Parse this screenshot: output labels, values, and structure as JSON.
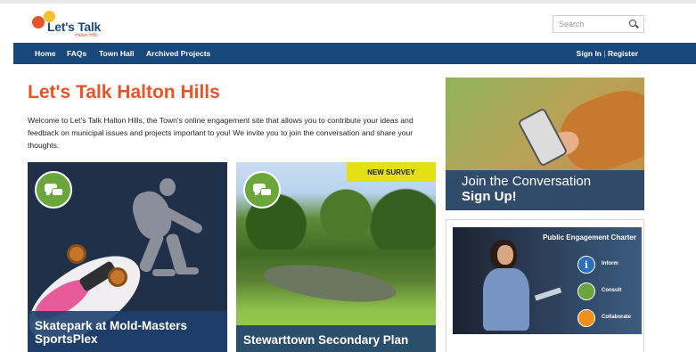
{
  "header": {
    "logo_name": "Let's Talk",
    "logo_sub": "Halton Hills",
    "search_placeholder": "Search"
  },
  "nav": {
    "items": [
      "Home",
      "FAQs",
      "Town Hall",
      "Archived Projects"
    ],
    "sign_in": "Sign In",
    "separator": "|",
    "register": "Register"
  },
  "intro": {
    "title": "Let's Talk Halton Hills",
    "body": "Welcome to Let's Talk Halton Hills, the Town's online engagement site that allows you to contribute your ideas and feedback on municipal issues and projects important to you! We invite you to join the conversation and share your thoughts."
  },
  "tiles": [
    {
      "caption": "Skatepark at Mold-Masters SportsPlex",
      "icon": "discussion-icon"
    },
    {
      "caption": "Stewarttown Secondary Plan",
      "badge": "NEW SURVEY",
      "icon": "discussion-icon"
    }
  ],
  "join": {
    "line1": "Join the Conversation",
    "line2": "Sign Up!"
  },
  "charter": {
    "title": "Public Engagement Charter",
    "levels": [
      {
        "label": "Inform",
        "glyph": "i",
        "icon": "info-icon"
      },
      {
        "label": "Consult",
        "icon": "chat-icon"
      },
      {
        "label": "Collaborate",
        "icon": "people-icon"
      }
    ]
  },
  "colors": {
    "brand_blue": "#17477b",
    "accent_orange": "#e8542a",
    "accent_green": "#6aa63b",
    "badge_yellow": "#e4e014"
  }
}
